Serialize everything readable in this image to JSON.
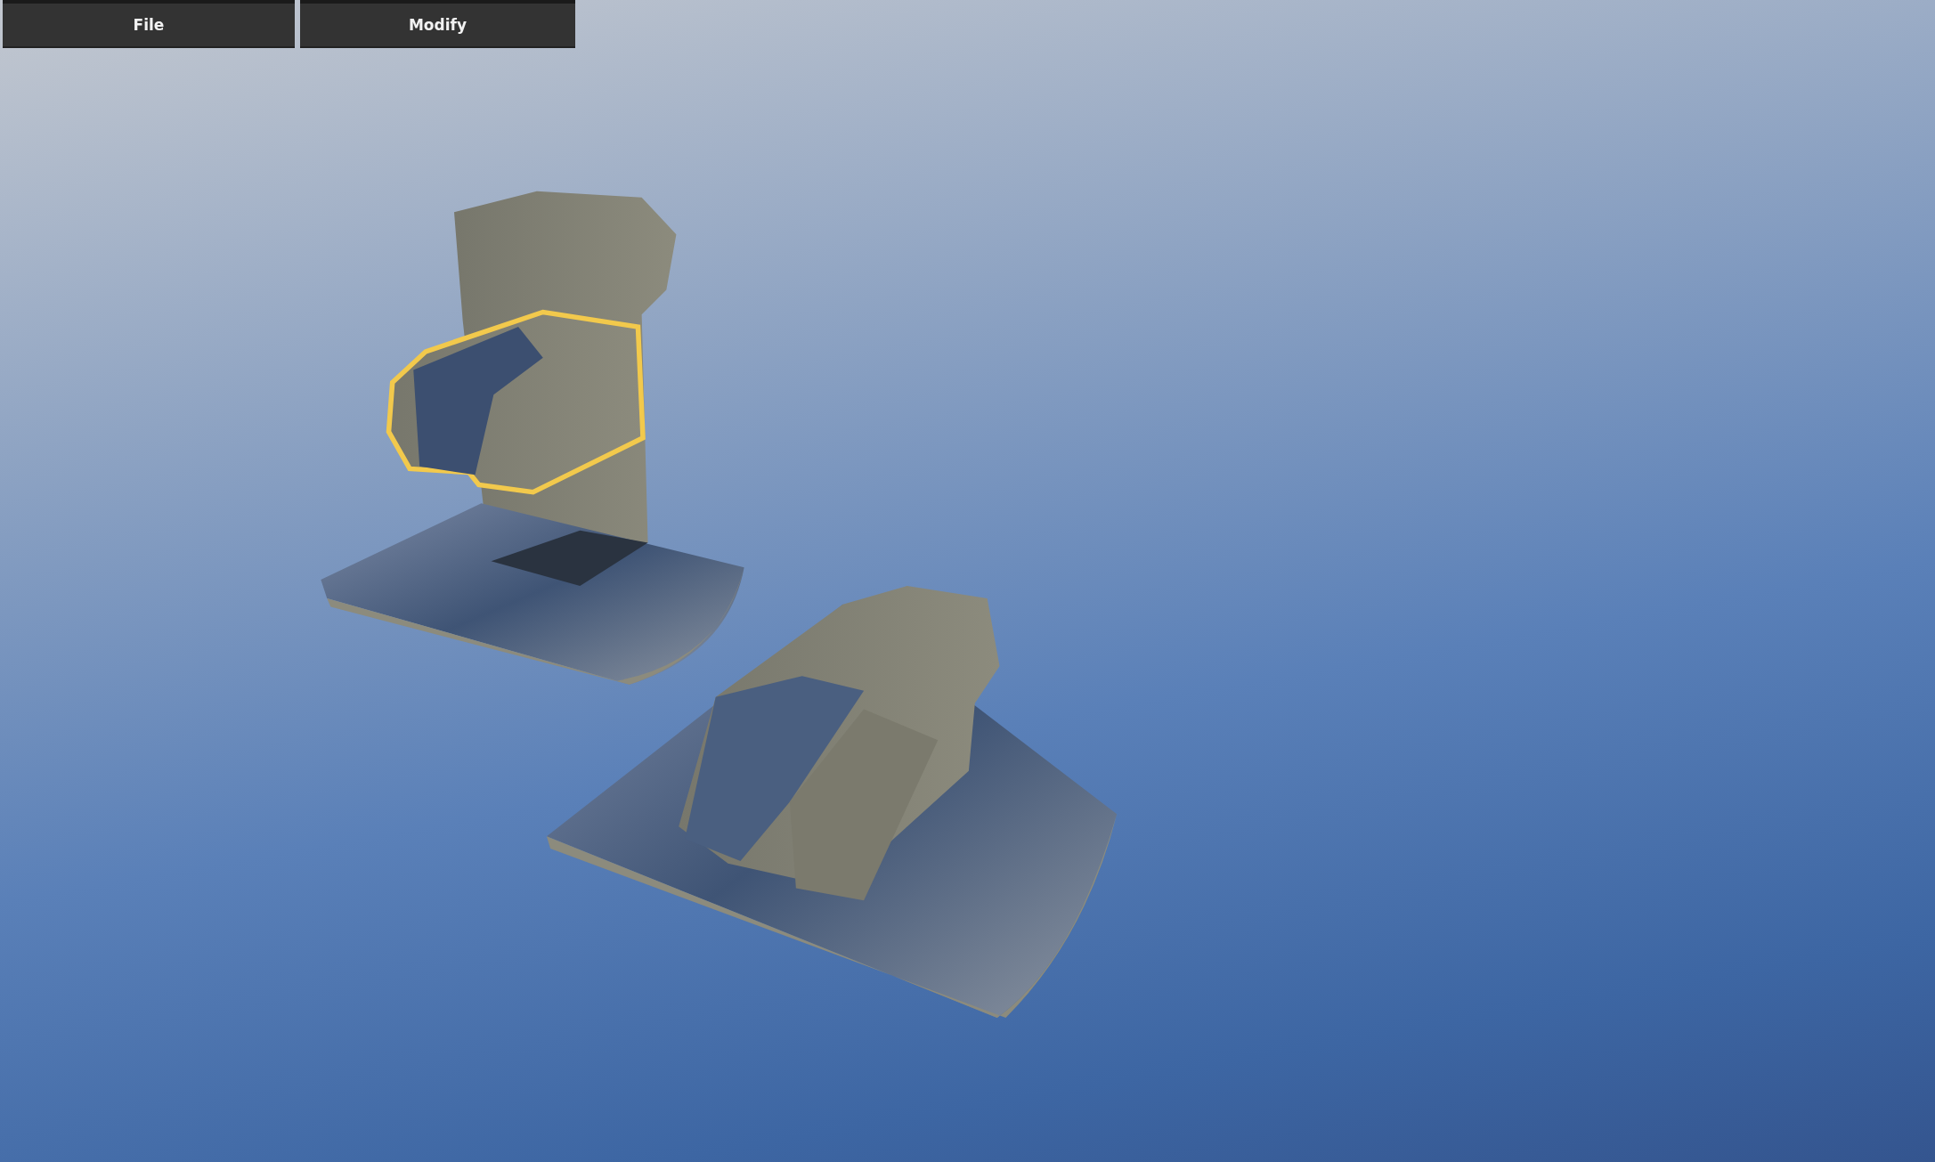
{
  "menu_bar": {
    "buttons": [
      "File",
      "Modify"
    ]
  }
}
